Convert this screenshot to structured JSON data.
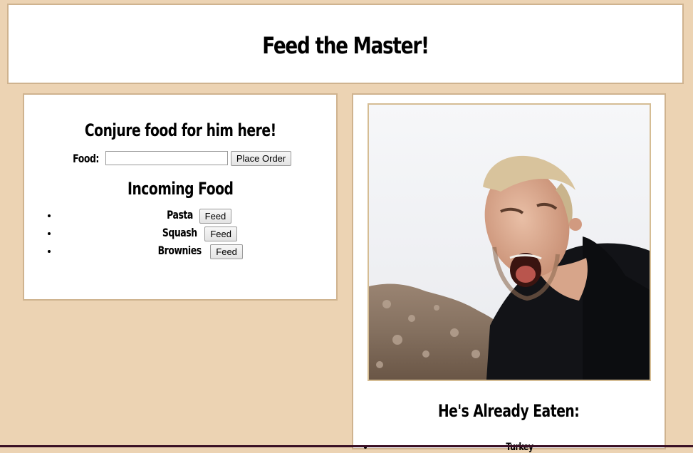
{
  "header": {
    "title": "Feed the Master!"
  },
  "order_panel": {
    "heading": "Conjure food for him here!",
    "food_label": "Food:",
    "food_value": "",
    "place_order_label": "Place Order",
    "incoming_heading": "Incoming Food",
    "incoming_items": [
      {
        "name": "Pasta",
        "button": "Feed"
      },
      {
        "name": "Squash",
        "button": "Feed"
      },
      {
        "name": "Brownies",
        "button": "Feed"
      }
    ]
  },
  "master_panel": {
    "eaten_heading": "He's Already Eaten:",
    "eaten_items": [
      "Turkey"
    ]
  },
  "colors": {
    "page_background": "#ecd3b3",
    "panel_border": "#cfb38f",
    "panel_background": "#ffffff"
  }
}
